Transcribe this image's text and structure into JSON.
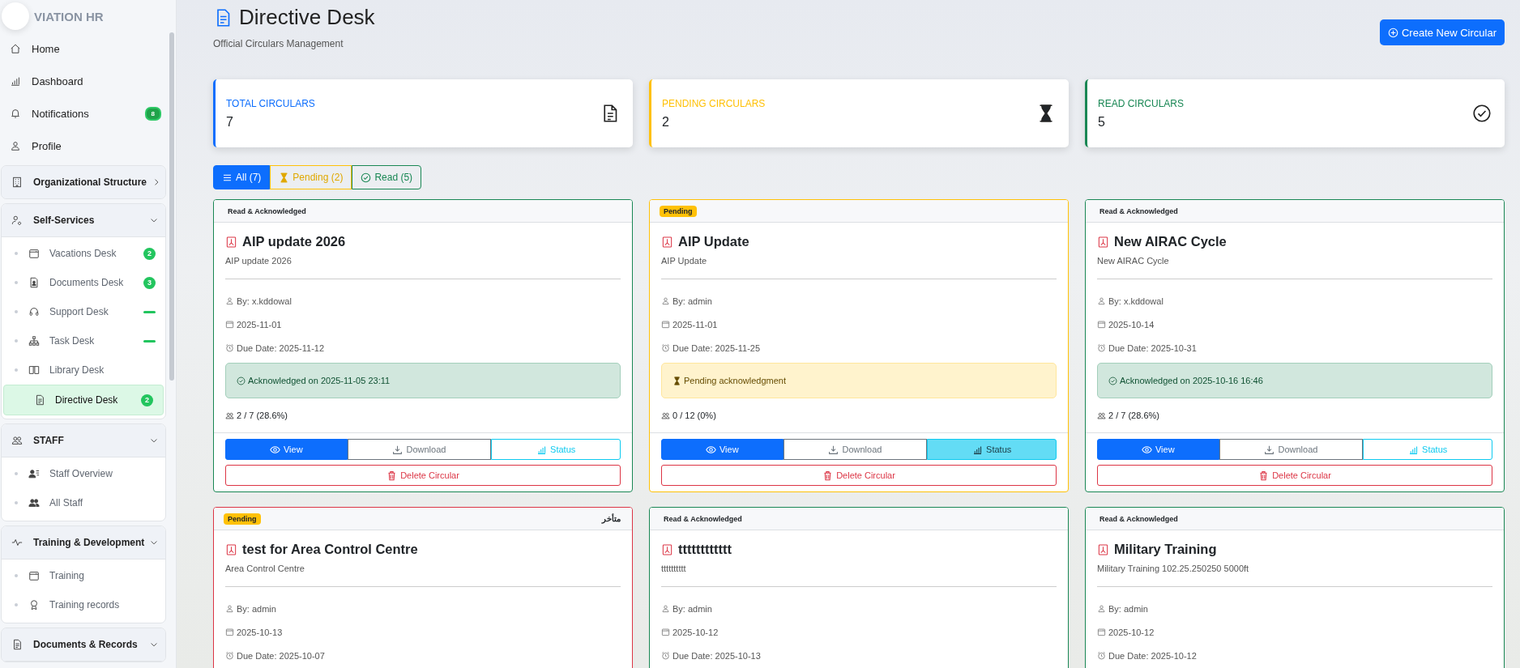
{
  "sidebar": {
    "brand": "VIATION HR",
    "items": [
      {
        "label": "Home",
        "selected": false
      },
      {
        "label": "Dashboard",
        "selected": false
      },
      {
        "label": "Notifications",
        "selected": false,
        "badge": "8"
      },
      {
        "label": "Profile",
        "selected": false
      }
    ],
    "sections": [
      {
        "label": "Organizational Structure",
        "expanded": false
      },
      {
        "label": "Self-Services",
        "expanded": true,
        "children": [
          {
            "label": "Vacations Desk",
            "selected": false,
            "badge": "2"
          },
          {
            "label": "Documents Desk",
            "selected": false,
            "badge": "3"
          },
          {
            "label": "Support Desk",
            "selected": false,
            "bar": true
          },
          {
            "label": "Task Desk",
            "selected": false,
            "bar": true
          },
          {
            "label": "Library Desk",
            "selected": false
          },
          {
            "label": "Directive Desk",
            "selected": true,
            "badge": "2"
          }
        ]
      },
      {
        "label": "STAFF",
        "expanded": true,
        "children": [
          {
            "label": "Staff Overview",
            "selected": false
          },
          {
            "label": "All Staff",
            "selected": false
          }
        ]
      },
      {
        "label": "Training & Development",
        "expanded": true,
        "children": [
          {
            "label": "Training",
            "selected": false
          },
          {
            "label": "Training records",
            "selected": false
          }
        ]
      },
      {
        "label": "Documents & Records",
        "expanded": true
      }
    ]
  },
  "header": {
    "title": "Directive Desk",
    "subtitle": "Official Circulars Management",
    "create_button": "Create New Circular"
  },
  "stats": [
    {
      "kind": "total",
      "label": "TOTAL CIRCULARS",
      "value": "7",
      "color": "#0d6efd"
    },
    {
      "kind": "pending",
      "label": "PENDING CIRCULARS",
      "value": "2",
      "color": "#ffc107"
    },
    {
      "kind": "read",
      "label": "READ CIRCULARS",
      "value": "5",
      "color": "#198754"
    }
  ],
  "filters": [
    {
      "kind": "all",
      "label": "All (7)",
      "selected": true
    },
    {
      "kind": "pending",
      "label": "Pending (2)",
      "selected": false
    },
    {
      "kind": "read",
      "label": "Read (5)",
      "selected": false
    }
  ],
  "circulars": [
    {
      "kind": "read",
      "badge": "Read & Acknowledged",
      "title": "AIP update 2026",
      "description": "AIP update 2026",
      "by": "By: x.kddowal",
      "date": "2025-11-01",
      "due": "Due Date: 2025-11-12",
      "alert": "Acknowledged on 2025-11-05 23:11",
      "progress": "2 / 7 (28.6%)",
      "actions": {
        "view": "View",
        "download": "Download",
        "status": "Status",
        "delete": "Delete Circular"
      },
      "status_active": false
    },
    {
      "kind": "pending",
      "badge": "Pending",
      "title": "AIP Update",
      "description": "AIP Update",
      "by": "By: admin",
      "date": "2025-11-01",
      "due": "Due Date: 2025-11-25",
      "alert": "Pending acknowledgment",
      "progress": "0 / 12 (0%)",
      "actions": {
        "view": "View",
        "download": "Download",
        "status": "Status",
        "delete": "Delete Circular"
      },
      "status_active": true
    },
    {
      "kind": "read",
      "badge": "Read & Acknowledged",
      "title": "New AIRAC Cycle",
      "description": "New AIRAC Cycle",
      "by": "By: x.kddowal",
      "date": "2025-10-14",
      "due": "Due Date: 2025-10-31",
      "alert": "Acknowledged on 2025-10-16 16:46",
      "progress": "2 / 7 (28.6%)",
      "actions": {
        "view": "View",
        "download": "Download",
        "status": "Status",
        "delete": "Delete Circular"
      },
      "status_active": false
    },
    {
      "kind": "overdue",
      "badge": "Pending",
      "flag": "متأخر",
      "title": "test for Area Control Centre",
      "description": "Area Control Centre",
      "by": "By: admin",
      "date": "2025-10-13",
      "due": "Due Date: 2025-10-07"
    },
    {
      "kind": "read",
      "badge": "Read & Acknowledged",
      "title": "tttttttttttt",
      "description": "tttttttttt",
      "by": "By: admin",
      "date": "2025-10-12",
      "due": "Due Date: 2025-10-13"
    },
    {
      "kind": "read",
      "badge": "Read & Acknowledged",
      "title": "Military Training",
      "description": "Military Training 102.25.250250 5000ft",
      "by": "By: admin",
      "date": "2025-10-12",
      "due": "Due Date: 2025-10-12"
    }
  ]
}
